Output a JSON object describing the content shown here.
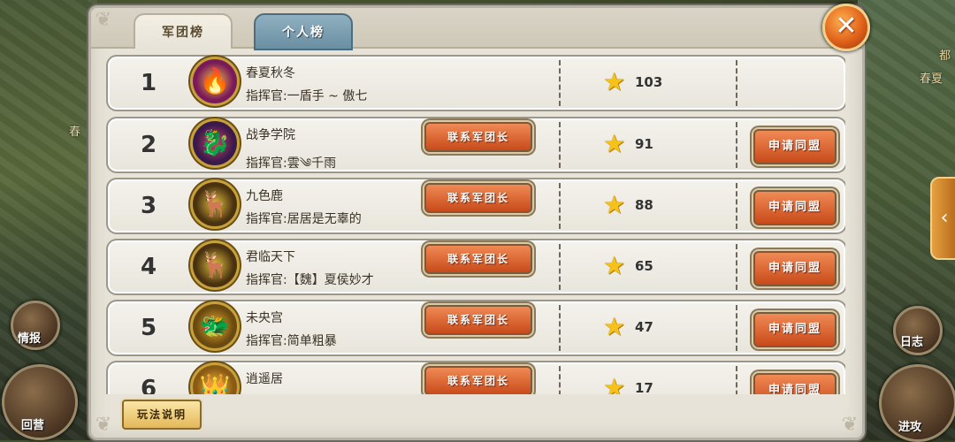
{
  "tabs": {
    "legion": "军团榜",
    "personal": "个人榜"
  },
  "close_icon": "✕",
  "map_labels": {
    "top_right": "都",
    "right": "春夏",
    "left": "春"
  },
  "corner_buttons": {
    "intel": "情报",
    "return": "回营",
    "daily": "日志",
    "attack": "进攻"
  },
  "buttons": {
    "contact": "联系军团长",
    "ally": "申请同盟",
    "rules": "玩法说明"
  },
  "commander_prefix": "指挥官:",
  "rows": [
    {
      "rank": "1",
      "name": "春夏秋冬",
      "commander": "指挥官:一盾手 ~ 傲七",
      "score": "103",
      "emblem_icon": "🔥",
      "emblem_color": "#7a1a5a",
      "has_buttons": false
    },
    {
      "rank": "2",
      "name": "战争学院",
      "commander": "指挥官:雲༄千雨",
      "score": "91",
      "emblem_icon": "🐉",
      "emblem_color": "#3a1a4a",
      "has_buttons": true
    },
    {
      "rank": "3",
      "name": "九色鹿",
      "commander": "指挥官:居居是无辜的",
      "score": "88",
      "emblem_icon": "🦌",
      "emblem_color": "#4a3210",
      "has_buttons": true
    },
    {
      "rank": "4",
      "name": "君临天下",
      "commander": "指挥官:【魏】夏侯妙才",
      "score": "65",
      "emblem_icon": "🦌",
      "emblem_color": "#4a3210",
      "has_buttons": true
    },
    {
      "rank": "5",
      "name": "未央宫",
      "commander": "指挥官:简单粗暴",
      "score": "47",
      "emblem_icon": "🐲",
      "emblem_color": "#6a4a10",
      "has_buttons": true
    },
    {
      "rank": "6",
      "name": "逍遥居",
      "commander": "",
      "score": "17",
      "emblem_icon": "👑",
      "emblem_color": "#8a5a14",
      "has_buttons": true
    }
  ]
}
